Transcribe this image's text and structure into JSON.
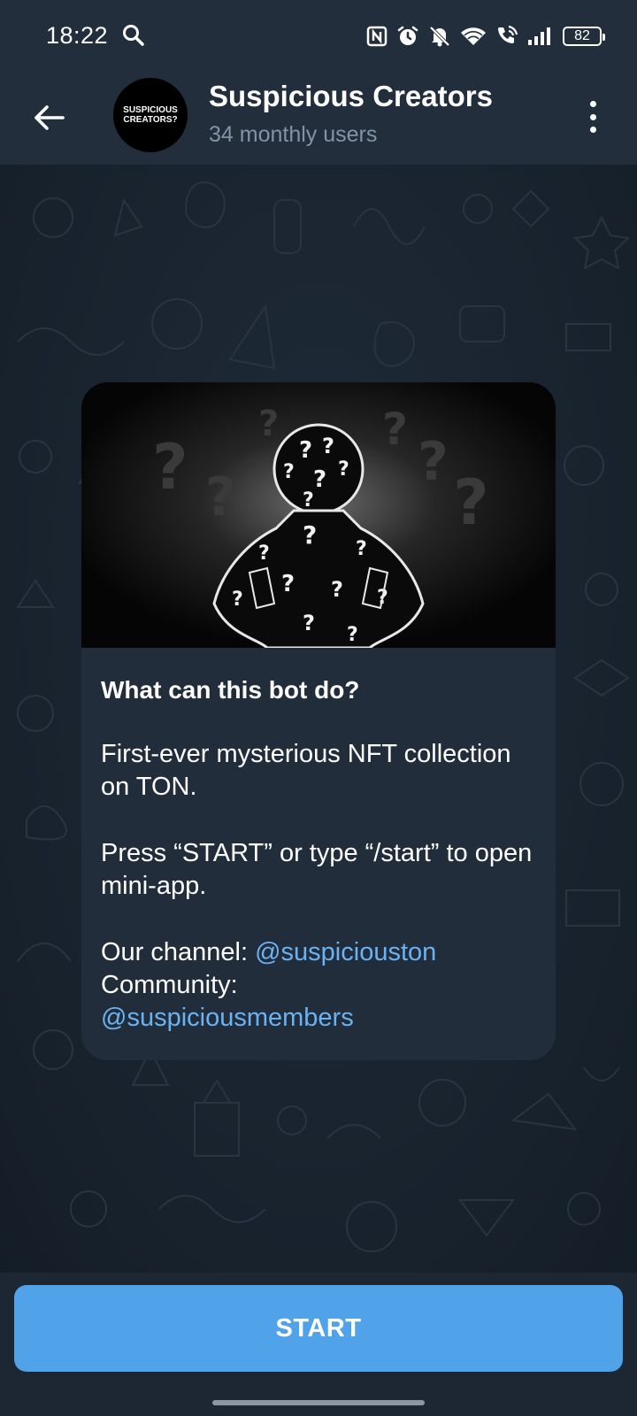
{
  "status_bar": {
    "time": "18:22",
    "battery": "82",
    "icons": [
      "search-icon",
      "nfc-icon",
      "alarm-icon",
      "mute-icon",
      "wifi-icon",
      "wifi-call-icon",
      "signal-icon",
      "battery-icon"
    ]
  },
  "header": {
    "title": "Suspicious Creators",
    "subtitle": "34 monthly users",
    "avatar_text": "SUSPICIOUS CREATORS?"
  },
  "card": {
    "heading": "What can this bot do?",
    "paragraph1": "First-ever mysterious NFT collection on TON.",
    "paragraph2": "Press “START” or type “/start” to open mini-app.",
    "channel_label": "Our channel: ",
    "channel_link": "@suspiciouston",
    "community_label": "Community: ",
    "community_link": "@suspiciousmembers"
  },
  "bottom": {
    "start_label": "START"
  },
  "colors": {
    "header_bg": "#232e3c",
    "chat_bg": "#18222d",
    "card_bg": "#222d3b",
    "link": "#6ab3f3",
    "button": "#50a2e9",
    "subtitle": "#8193a5"
  }
}
